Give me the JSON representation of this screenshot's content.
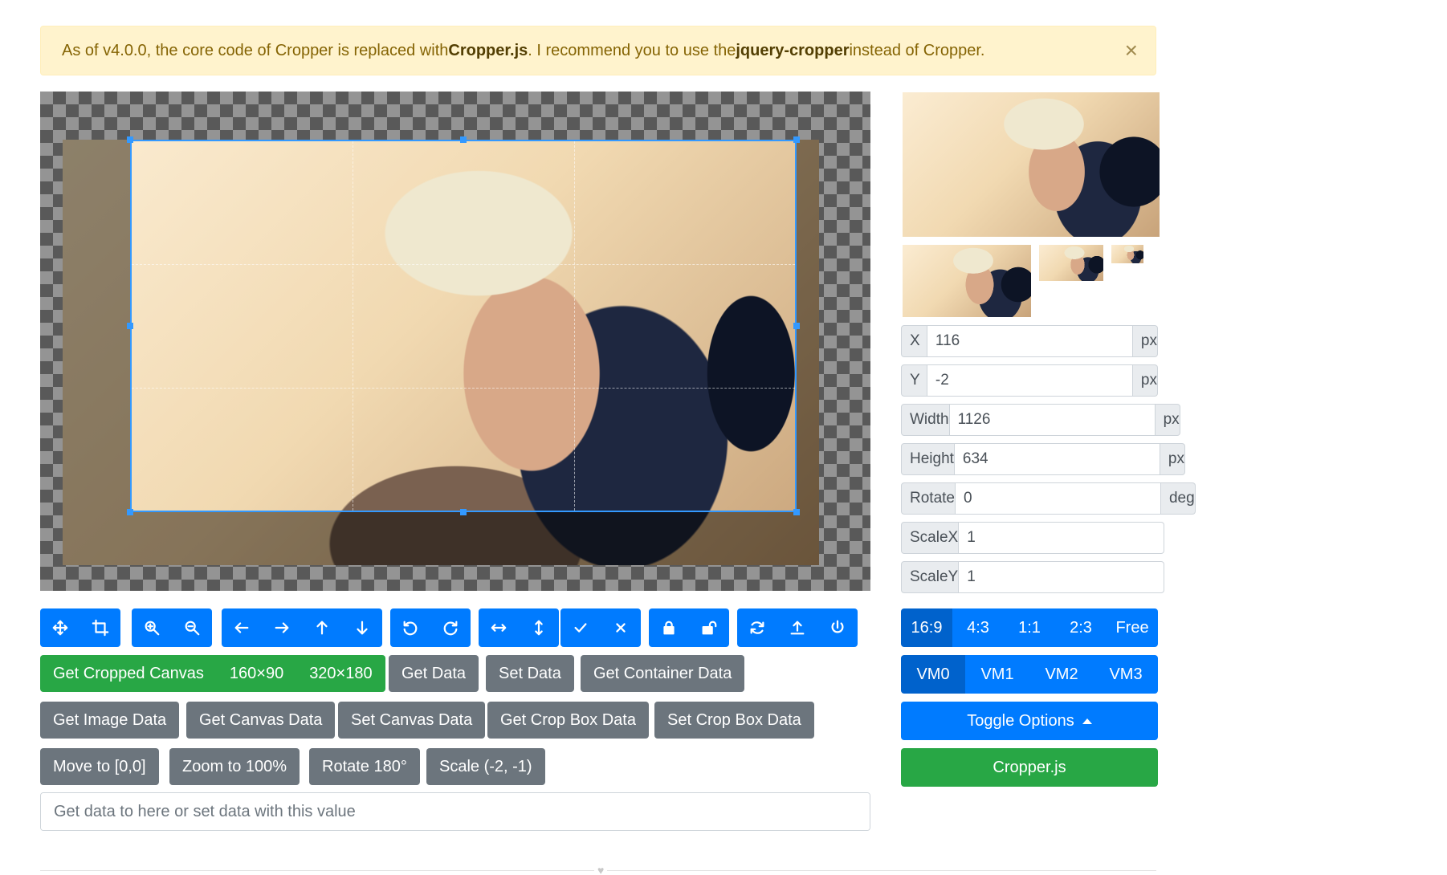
{
  "alert": {
    "prefix": "As of v4.0.0, the core code of Cropper is replaced with ",
    "link1": "Cropper.js",
    "middle": ". I recommend you to use the ",
    "link2": "jquery-cropper",
    "suffix": " instead of Cropper.",
    "close": "×"
  },
  "toolbar": {
    "cropped_canvas": "Get Cropped Canvas",
    "size_160": "160×90",
    "size_320": "320×180",
    "get_data": "Get Data",
    "set_data": "Set Data",
    "get_container_data": "Get Container Data",
    "get_image_data": "Get Image Data",
    "get_canvas_data": "Get Canvas Data",
    "set_canvas_data": "Set Canvas Data",
    "get_crop_box_data": "Get Crop Box Data",
    "set_crop_box_data": "Set Crop Box Data",
    "move_to": "Move to [0,0]",
    "zoom_to": "Zoom to 100%",
    "rotate_180": "Rotate 180°",
    "scale": "Scale (-2, -1)"
  },
  "data_field": {
    "placeholder": "Get data to here or set data with this value"
  },
  "fields": {
    "x": {
      "label": "X",
      "value": "116",
      "unit": "px"
    },
    "y": {
      "label": "Y",
      "value": "-2",
      "unit": "px"
    },
    "width": {
      "label": "Width",
      "value": "1126",
      "unit": "px"
    },
    "height": {
      "label": "Height",
      "value": "634",
      "unit": "px"
    },
    "rotate": {
      "label": "Rotate",
      "value": "0",
      "unit": "deg"
    },
    "scaleX": {
      "label": "ScaleX",
      "value": "1"
    },
    "scaleY": {
      "label": "ScaleY",
      "value": "1"
    }
  },
  "aspect_ratios": [
    "16:9",
    "4:3",
    "1:1",
    "2:3",
    "Free"
  ],
  "view_modes": [
    "VM0",
    "VM1",
    "VM2",
    "VM3"
  ],
  "toggle_options": "Toggle Options",
  "cropperjs_link": "Cropper.js",
  "footer_heart": "♥",
  "colors": {
    "primary": "#007bff",
    "secondary": "#6c757d",
    "success": "#28a745",
    "crop_border": "#3399ff",
    "alert_bg": "#fff3cd"
  }
}
